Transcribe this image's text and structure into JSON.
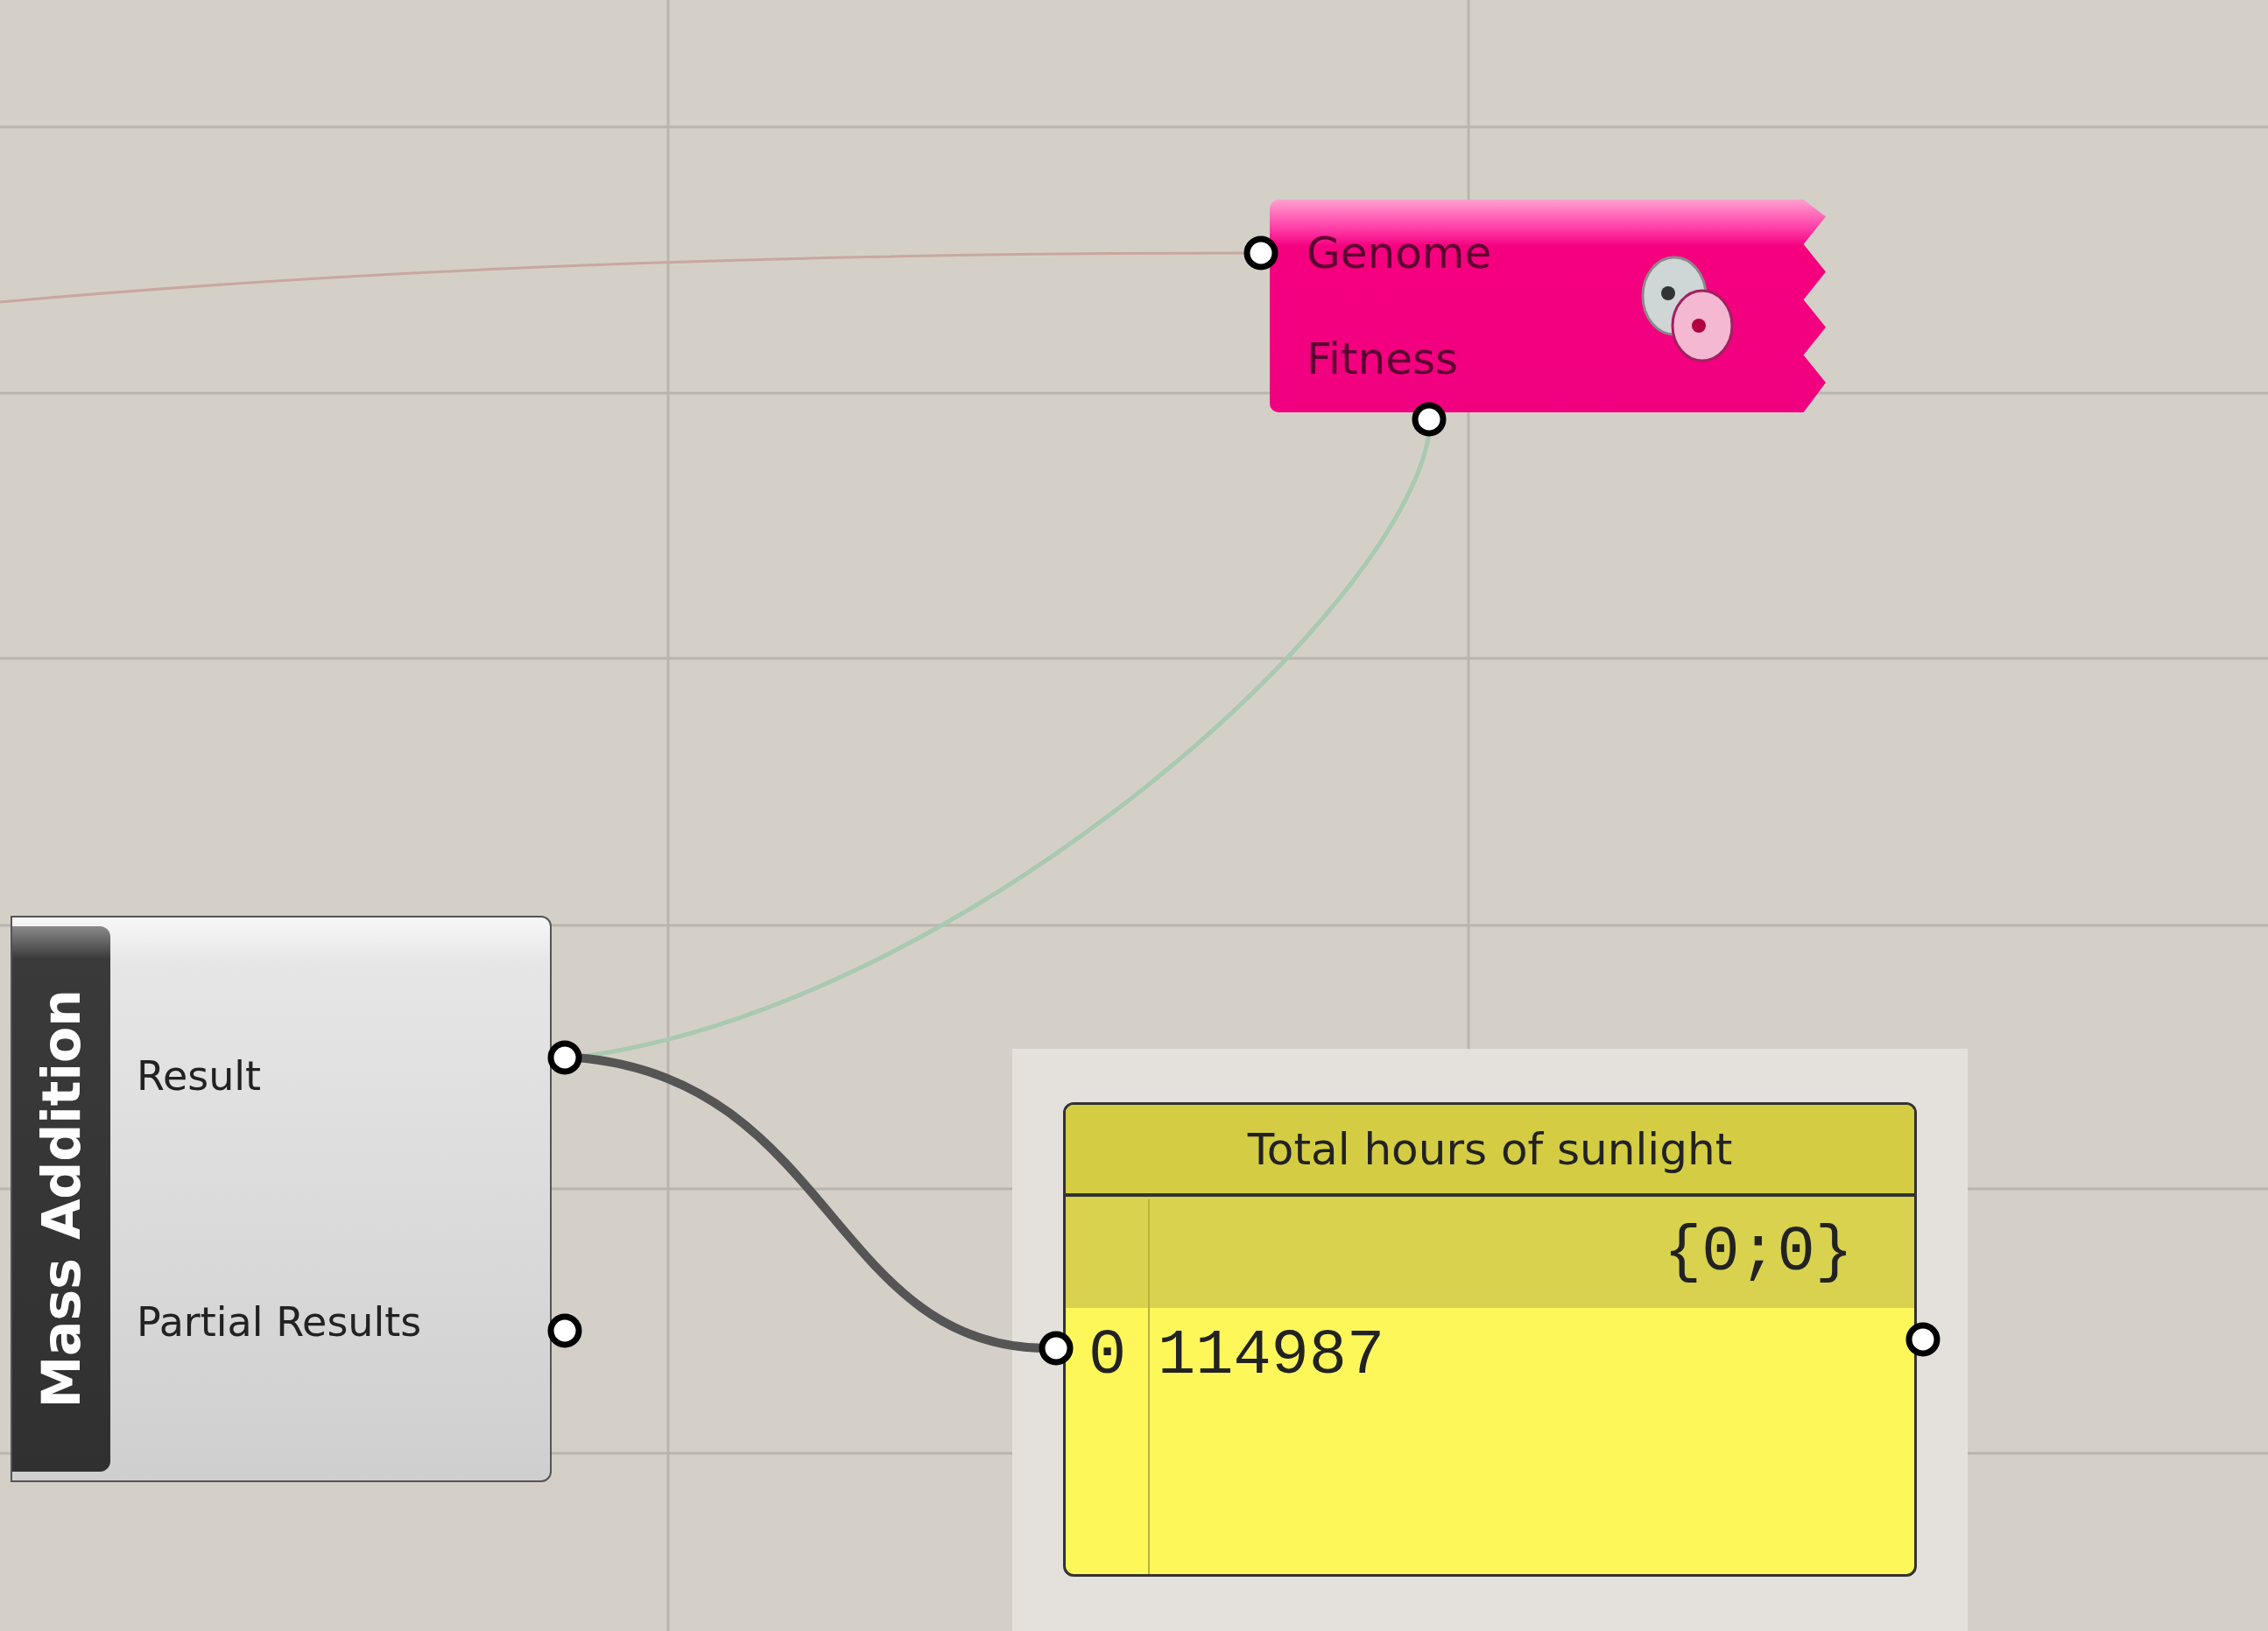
{
  "galapagos_node": {
    "inputs": [
      {
        "label": "Genome"
      },
      {
        "label": "Fitness"
      }
    ]
  },
  "mass_addition_node": {
    "title": "Mass Addition",
    "outputs": [
      {
        "label": "Result"
      },
      {
        "label": "Partial Results"
      }
    ]
  },
  "panel": {
    "title": "Total hours of sunlight",
    "path": "{0;0}",
    "rows": [
      {
        "index": "0",
        "value": "114987"
      }
    ]
  }
}
